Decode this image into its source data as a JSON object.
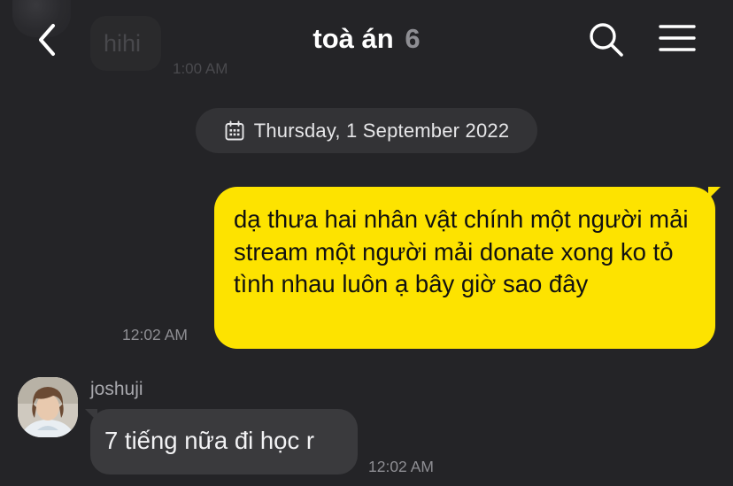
{
  "header": {
    "title": "toà án",
    "member_count": "6",
    "back_icon": "chevron-left-icon",
    "search_icon": "search-icon",
    "menu_icon": "hamburger-menu-icon"
  },
  "previous_message": {
    "text": "hihi",
    "time": "1:00 AM"
  },
  "date_divider": {
    "icon": "calendar-icon",
    "text": "Thursday, 1 September 2022"
  },
  "messages": [
    {
      "direction": "outgoing",
      "text": "dạ thưa hai nhân vật chính một người mải stream một người mải donate xong ko tỏ tình nhau luôn ạ bây giờ sao đây",
      "time": "12:02 AM",
      "bubble_color": "#fde300"
    },
    {
      "direction": "incoming",
      "sender": "joshuji",
      "text": "7 tiếng nữa đi học r",
      "time": "12:02 AM",
      "bubble_color": "#3a3a3d"
    }
  ],
  "colors": {
    "background": "#242427",
    "accent_yellow": "#fde300",
    "muted_text": "#8e8e93"
  }
}
